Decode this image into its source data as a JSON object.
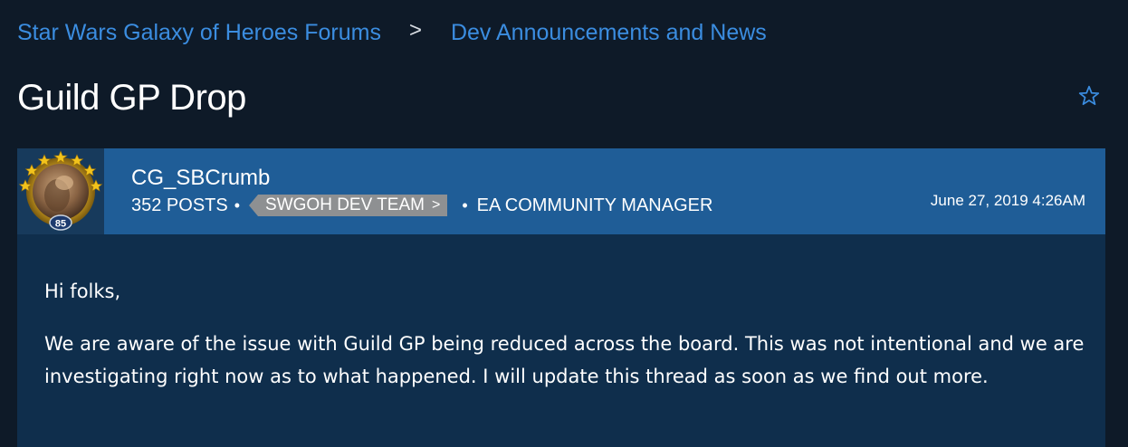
{
  "breadcrumb": {
    "forum": "Star Wars Galaxy of Heroes Forums",
    "separator": ">",
    "category": "Dev Announcements and News"
  },
  "thread": {
    "title": "Guild GP Drop"
  },
  "post": {
    "author": "CG_SBCrumb",
    "avatar_level": "85",
    "posts_count": "352 POSTS",
    "dot": "•",
    "team_badge": "SWGOH DEV TEAM",
    "badge_chevron": ">",
    "role": "EA COMMUNITY MANAGER",
    "date": "June 27, 2019 4:26AM",
    "body": [
      "Hi folks,",
      "We are aware of the issue with Guild GP being reduced across the board. This was not intentional and we are investigating right now as to what happened. I will update this thread as soon as we find out more."
    ]
  },
  "icons": {
    "bookmark": "star-outline-icon"
  },
  "colors": {
    "page_bg": "#0e1a28",
    "link": "#3b8de0",
    "header_bar": "#1f5d97",
    "post_bg": "#0f2e4c",
    "badge": "#8e9092"
  }
}
